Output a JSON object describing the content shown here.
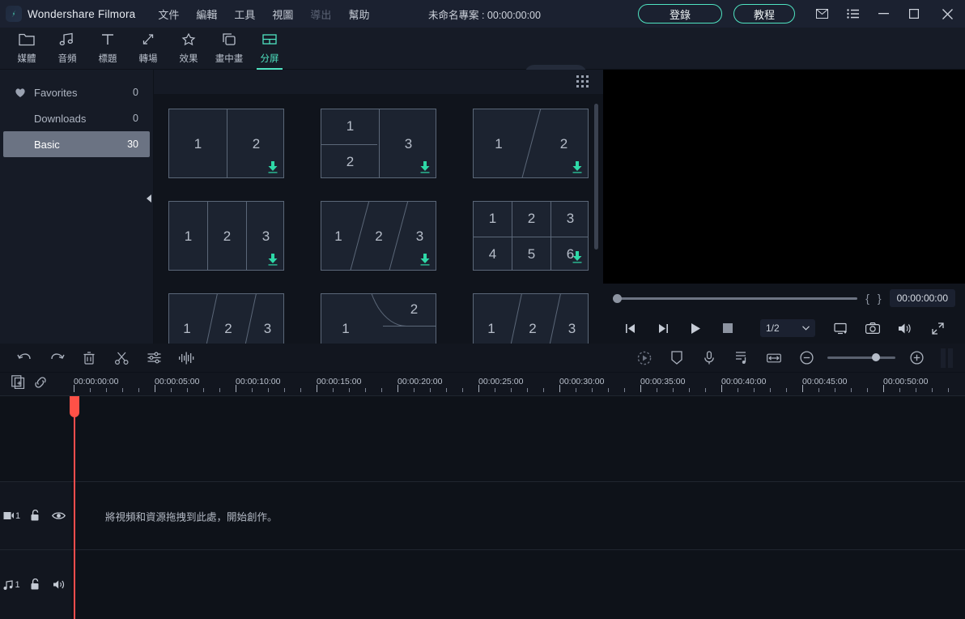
{
  "titlebar": {
    "app_name": "Wondershare Filmora",
    "menus": [
      {
        "label": "文件",
        "disabled": false
      },
      {
        "label": "編輯",
        "disabled": false
      },
      {
        "label": "工具",
        "disabled": false
      },
      {
        "label": "視圖",
        "disabled": false
      },
      {
        "label": "導出",
        "disabled": true
      },
      {
        "label": "幫助",
        "disabled": false
      }
    ],
    "project_title": "未命名專案 : 00:00:00:00",
    "login_label": "登錄",
    "tutorial_label": "教程",
    "icons": [
      "mail-icon",
      "list-icon",
      "minimize-icon",
      "maximize-icon",
      "close-icon"
    ]
  },
  "toolbar": {
    "tabs": [
      {
        "label": "媒體",
        "icon": "folder-icon",
        "active": false
      },
      {
        "label": "音頻",
        "icon": "music-note-icon",
        "active": false
      },
      {
        "label": "標題",
        "icon": "text-t-icon",
        "active": false
      },
      {
        "label": "轉場",
        "icon": "transition-arrows-icon",
        "active": false
      },
      {
        "label": "效果",
        "icon": "sparkle-icon",
        "active": false
      },
      {
        "label": "畫中畫",
        "icon": "picture-in-picture-icon",
        "active": false
      },
      {
        "label": "分屏",
        "icon": "split-screen-icon",
        "active": true
      }
    ],
    "export_label": "導出",
    "export_disabled": true
  },
  "library_sidebar": {
    "items": [
      {
        "label": "Favorites",
        "count": "0",
        "icon": "heart-icon",
        "selected": false
      },
      {
        "label": "Downloads",
        "count": "0",
        "icon": "",
        "selected": false
      },
      {
        "label": "Basic",
        "count": "30",
        "icon": "",
        "selected": true
      }
    ]
  },
  "browser": {
    "templates": [
      {
        "id": "tpl-1",
        "layout": "two-vertical",
        "cells": [
          "1",
          "2"
        ],
        "downloadable": true
      },
      {
        "id": "tpl-2",
        "layout": "left-stack-two-right-one",
        "cells": [
          "1",
          "2",
          "3"
        ],
        "downloadable": true
      },
      {
        "id": "tpl-3",
        "layout": "two-diagonal",
        "cells": [
          "1",
          "2"
        ],
        "downloadable": true
      },
      {
        "id": "tpl-4",
        "layout": "three-vertical",
        "cells": [
          "1",
          "2",
          "3"
        ],
        "downloadable": true
      },
      {
        "id": "tpl-5",
        "layout": "three-diagonal",
        "cells": [
          "1",
          "2",
          "3"
        ],
        "downloadable": true
      },
      {
        "id": "tpl-6",
        "layout": "grid-2x3",
        "cells": [
          "1",
          "2",
          "3",
          "4",
          "5",
          "6"
        ],
        "downloadable": true
      },
      {
        "id": "tpl-7",
        "layout": "three-diagonal-b",
        "cells": [
          "1",
          "2",
          "3"
        ],
        "downloadable": false
      },
      {
        "id": "tpl-8",
        "layout": "curve-two",
        "cells": [
          "1",
          "2"
        ],
        "downloadable": false
      },
      {
        "id": "tpl-9",
        "layout": "three-diagonal-c",
        "cells": [
          "1",
          "2",
          "3"
        ],
        "downloadable": false
      }
    ]
  },
  "preview": {
    "timecode": "00:00:00:00",
    "mark_in": "{",
    "mark_out": "}",
    "ratio": "1/2",
    "controls": [
      {
        "name": "prev-frame-button",
        "icon": "step-back-icon"
      },
      {
        "name": "next-frame-button",
        "icon": "step-forward-icon"
      },
      {
        "name": "play-button",
        "icon": "play-icon"
      },
      {
        "name": "stop-button",
        "icon": "stop-icon"
      }
    ],
    "right_controls": [
      {
        "name": "display-settings-button",
        "icon": "monitor-icon"
      },
      {
        "name": "snapshot-button",
        "icon": "camera-icon"
      },
      {
        "name": "volume-button",
        "icon": "speaker-icon"
      },
      {
        "name": "fullscreen-button",
        "icon": "expand-icon"
      }
    ]
  },
  "timeline": {
    "left_tools": [
      {
        "name": "undo-button",
        "icon": "undo-arrow-icon"
      },
      {
        "name": "redo-button",
        "icon": "redo-arrow-icon"
      },
      {
        "name": "delete-button",
        "icon": "trash-icon"
      },
      {
        "name": "split-button",
        "icon": "scissors-icon"
      },
      {
        "name": "adjust-button",
        "icon": "sliders-icon"
      },
      {
        "name": "audio-detach-button",
        "icon": "waveform-icon"
      }
    ],
    "right_tools": [
      {
        "name": "render-preview-button",
        "icon": "render-play-icon"
      },
      {
        "name": "marker-button",
        "icon": "marker-shield-icon"
      },
      {
        "name": "voiceover-button",
        "icon": "microphone-icon"
      },
      {
        "name": "audio-mixer-button",
        "icon": "audio-mixer-icon"
      },
      {
        "name": "fit-timeline-button",
        "icon": "fit-arrows-icon"
      },
      {
        "name": "zoom-out-button",
        "icon": "minus-circle-icon"
      },
      {
        "name": "zoom-in-button",
        "icon": "plus-circle-icon"
      }
    ],
    "ruler_tools": [
      {
        "name": "add-track-button",
        "icon": "add-track-icon"
      },
      {
        "name": "link-button",
        "icon": "link-chain-icon"
      }
    ],
    "ruler_labels": [
      "00:00:00:00",
      "00:00:05:00",
      "00:00:10:00",
      "00:00:15:00",
      "00:00:20:00",
      "00:00:25:00",
      "00:00:30:00",
      "00:00:35:00",
      "00:00:40:00",
      "00:00:45:00",
      "00:00:50:00"
    ],
    "playhead_position": "00:00:00:00",
    "tracks": [
      {
        "type": "video",
        "label": "1",
        "icon": "video-track-icon",
        "lock_icon": "unlock-icon",
        "toggle_icon": "eye-icon",
        "drop_hint": "將視頻和資源拖拽到此處，開始創作。"
      },
      {
        "type": "audio",
        "label": "1",
        "icon": "audio-track-icon",
        "lock_icon": "unlock-icon",
        "toggle_icon": "speaker-icon",
        "drop_hint": ""
      }
    ]
  },
  "colors": {
    "accent": "#4fe3c1",
    "download_arrow": "#2ed8a7",
    "playhead": "#ff4d4d",
    "titlebar_bg": "#1b2130",
    "panel_bg": "#161b26"
  }
}
